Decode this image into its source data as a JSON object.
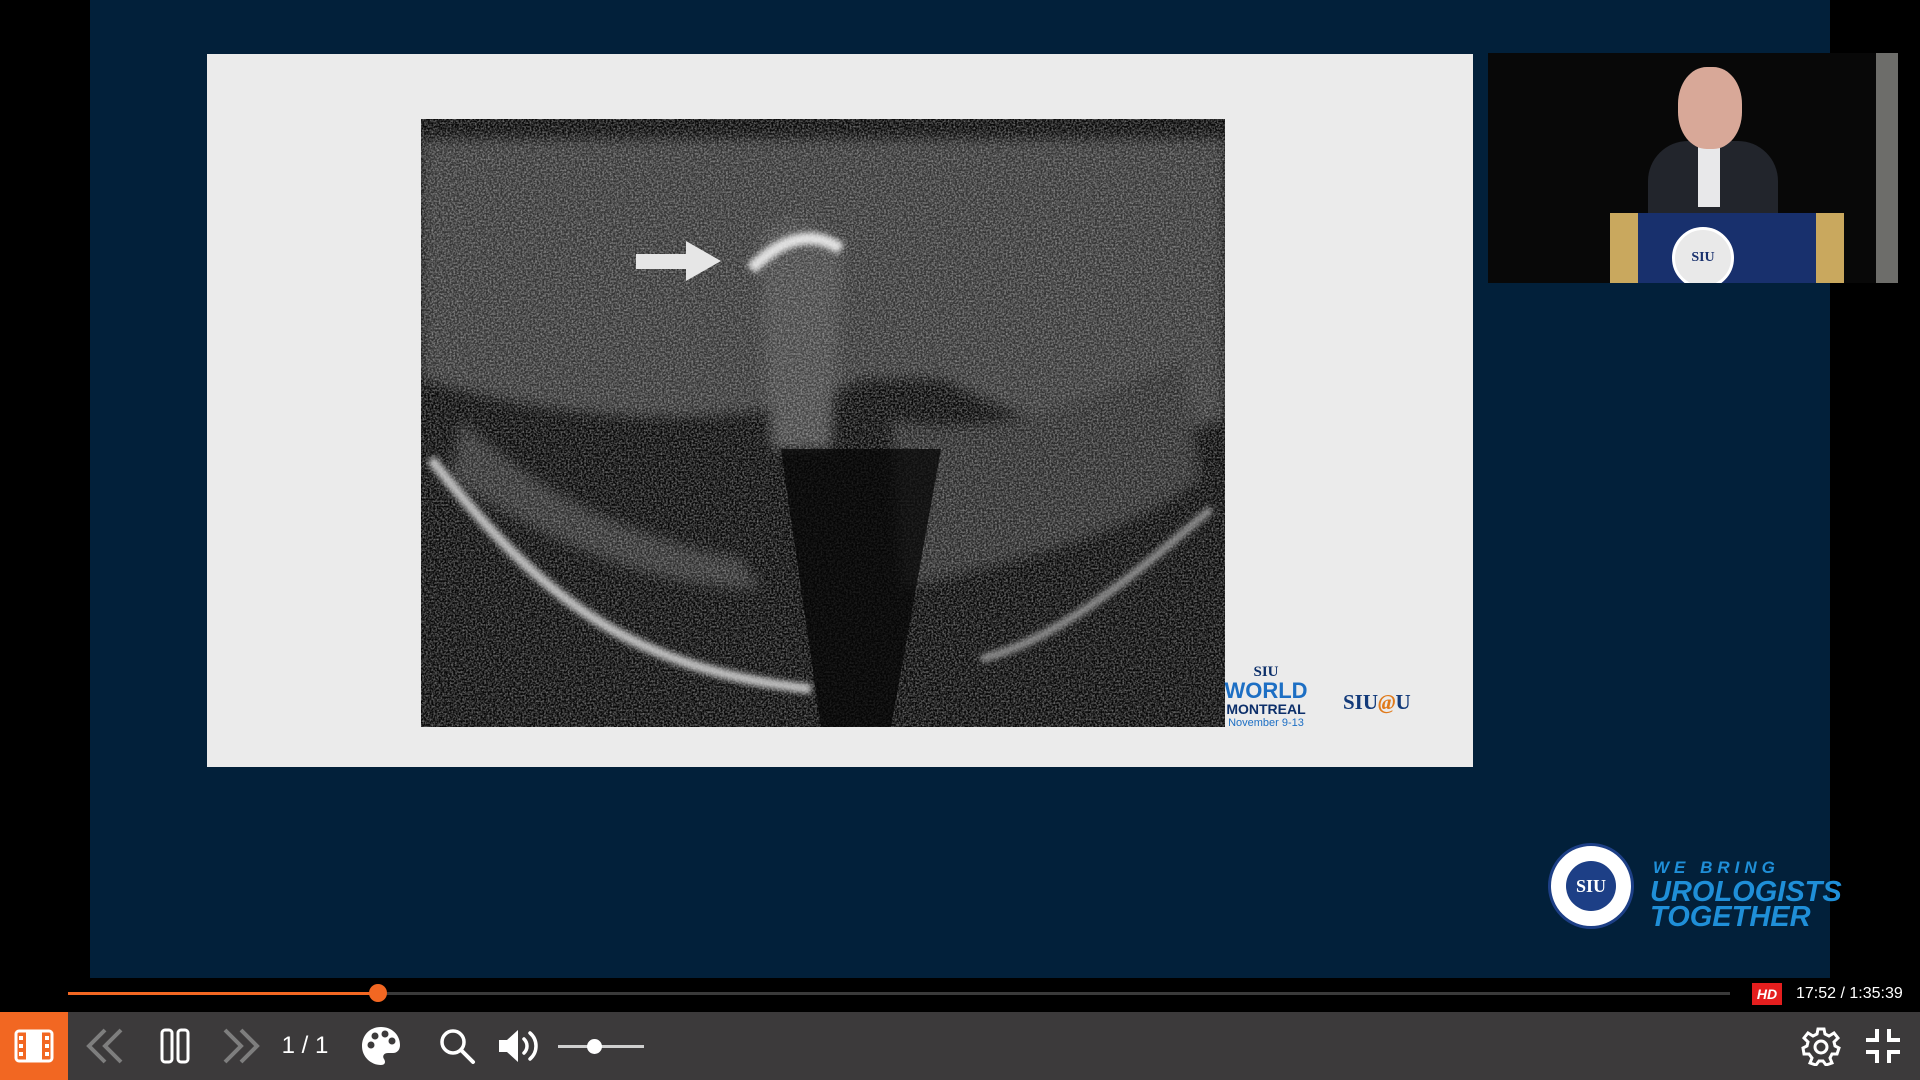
{
  "player": {
    "slide": {
      "logo_world": {
        "line1": "SIU",
        "line2": "WORLD",
        "line3": "MONTREAL",
        "line4": "November 9-13"
      },
      "logo_siu_at_u": {
        "pre": "SIU",
        "at": "@",
        "post": "U"
      }
    },
    "speaker": {
      "podium_seal": "SIU"
    },
    "branding": {
      "seal": "SIU",
      "tagline_1": "WE BRING",
      "tagline_2": "UROLOGISTS",
      "tagline_3": "TOGETHER"
    },
    "progress": {
      "fraction": 0.1867,
      "hd_label": "HD",
      "time": "17:52 / 1:35:39"
    },
    "controls": {
      "page_indicator": "1 / 1",
      "volume_level": 0.42
    },
    "icons": {
      "menu": "film-menu-icon",
      "prev": "double-chevron-left-icon",
      "pause": "pause-icon",
      "next": "double-chevron-right-icon",
      "palette": "palette-icon",
      "search": "search-icon",
      "volume": "volume-icon",
      "settings": "gear-icon",
      "fullscreen": "exit-fullscreen-icon"
    },
    "colors": {
      "accent": "#f26722",
      "stage_bg": "#02203a",
      "hd_badge": "#e41e1e",
      "control_bar": "#3c3a3b"
    }
  }
}
